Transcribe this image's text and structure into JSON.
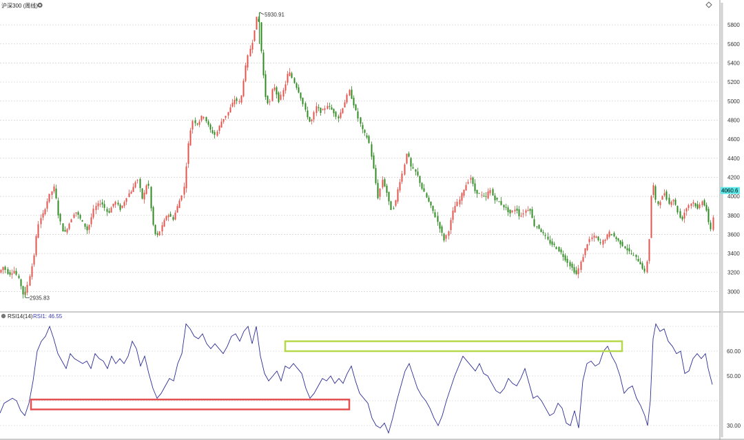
{
  "header": {
    "title": "沪深300 (周线)",
    "gear_icon": "gear-icon",
    "diamond_icon": "diamond-icon"
  },
  "indicator": {
    "label": "RSI14(14)",
    "value_label": "RSI1: 46.55"
  },
  "colors": {
    "up": "#e5534b",
    "down": "#2e8b22",
    "rsi_line": "#2b2b96",
    "grid": "#c8c8c8",
    "price_badge": "#5ce8e8",
    "rsi_highlight_high": "#b6d84a",
    "rsi_highlight_low": "#e55050"
  },
  "chart_data": [
    {
      "type": "candlestick",
      "title": "沪深300 (周线)",
      "yticks": [
        3000,
        3200,
        3400,
        3600,
        3800,
        4000,
        4200,
        4400,
        4600,
        4800,
        5000,
        5200,
        5400,
        5600,
        5800
      ],
      "ylim": [
        2880,
        5960
      ],
      "grid": true,
      "annotations": [
        {
          "text": "5930.91",
          "price": 5930.91,
          "kind": "high"
        },
        {
          "text": "2935.83",
          "price": 2935.83,
          "kind": "low"
        }
      ],
      "current_price": "4060.6",
      "path": [
        [
          0,
          3200
        ],
        [
          6,
          3260
        ],
        [
          14,
          3180
        ],
        [
          22,
          3220
        ],
        [
          30,
          3100
        ],
        [
          36,
          2936
        ],
        [
          42,
          3100
        ],
        [
          50,
          3350
        ],
        [
          56,
          3700
        ],
        [
          64,
          3820
        ],
        [
          72,
          4000
        ],
        [
          80,
          4100
        ],
        [
          86,
          3800
        ],
        [
          94,
          3600
        ],
        [
          102,
          3720
        ],
        [
          110,
          3850
        ],
        [
          118,
          3760
        ],
        [
          128,
          3640
        ],
        [
          138,
          3880
        ],
        [
          148,
          3940
        ],
        [
          158,
          3820
        ],
        [
          168,
          3950
        ],
        [
          176,
          3860
        ],
        [
          186,
          4010
        ],
        [
          194,
          4080
        ],
        [
          200,
          4200
        ],
        [
          208,
          3960
        ],
        [
          216,
          4180
        ],
        [
          222,
          3740
        ],
        [
          228,
          3560
        ],
        [
          236,
          3680
        ],
        [
          244,
          3820
        ],
        [
          252,
          3760
        ],
        [
          260,
          3920
        ],
        [
          268,
          4080
        ],
        [
          274,
          4520
        ],
        [
          280,
          4800
        ],
        [
          288,
          4760
        ],
        [
          296,
          4860
        ],
        [
          306,
          4700
        ],
        [
          314,
          4640
        ],
        [
          322,
          4780
        ],
        [
          332,
          4880
        ],
        [
          342,
          5020
        ],
        [
          350,
          4980
        ],
        [
          356,
          5300
        ],
        [
          362,
          5500
        ],
        [
          368,
          5640
        ],
        [
          372,
          5820
        ],
        [
          376,
          5931
        ],
        [
          380,
          5540
        ],
        [
          386,
          5060
        ],
        [
          392,
          4950
        ],
        [
          398,
          5180
        ],
        [
          406,
          5000
        ],
        [
          414,
          5140
        ],
        [
          420,
          5320
        ],
        [
          428,
          5200
        ],
        [
          436,
          5080
        ],
        [
          444,
          4900
        ],
        [
          452,
          4760
        ],
        [
          460,
          4940
        ],
        [
          468,
          4880
        ],
        [
          476,
          4960
        ],
        [
          484,
          4900
        ],
        [
          492,
          4820
        ],
        [
          500,
          4960
        ],
        [
          508,
          5110
        ],
        [
          514,
          4980
        ],
        [
          520,
          4840
        ],
        [
          528,
          4680
        ],
        [
          536,
          4600
        ],
        [
          544,
          4260
        ],
        [
          550,
          3980
        ],
        [
          556,
          4180
        ],
        [
          562,
          4060
        ],
        [
          568,
          3860
        ],
        [
          574,
          3900
        ],
        [
          580,
          4120
        ],
        [
          586,
          4260
        ],
        [
          592,
          4480
        ],
        [
          598,
          4300
        ],
        [
          606,
          4240
        ],
        [
          614,
          4080
        ],
        [
          622,
          3960
        ],
        [
          630,
          3840
        ],
        [
          638,
          3700
        ],
        [
          646,
          3540
        ],
        [
          652,
          3640
        ],
        [
          660,
          3880
        ],
        [
          668,
          3960
        ],
        [
          676,
          4100
        ],
        [
          684,
          4200
        ],
        [
          690,
          4060
        ],
        [
          698,
          4020
        ],
        [
          706,
          3980
        ],
        [
          712,
          4080
        ],
        [
          718,
          3980
        ],
        [
          726,
          3940
        ],
        [
          734,
          3880
        ],
        [
          742,
          3820
        ],
        [
          750,
          3880
        ],
        [
          756,
          3780
        ],
        [
          762,
          3840
        ],
        [
          770,
          3880
        ],
        [
          776,
          3700
        ],
        [
          782,
          3680
        ],
        [
          790,
          3600
        ],
        [
          798,
          3520
        ],
        [
          806,
          3480
        ],
        [
          814,
          3420
        ],
        [
          822,
          3340
        ],
        [
          830,
          3260
        ],
        [
          838,
          3180
        ],
        [
          846,
          3340
        ],
        [
          852,
          3480
        ],
        [
          858,
          3560
        ],
        [
          866,
          3580
        ],
        [
          872,
          3500
        ],
        [
          878,
          3540
        ],
        [
          886,
          3620
        ],
        [
          892,
          3580
        ],
        [
          900,
          3520
        ],
        [
          906,
          3480
        ],
        [
          914,
          3420
        ],
        [
          920,
          3380
        ],
        [
          926,
          3340
        ],
        [
          932,
          3280
        ],
        [
          938,
          3180
        ],
        [
          943,
          3500
        ],
        [
          948,
          4200
        ],
        [
          954,
          3900
        ],
        [
          960,
          3960
        ],
        [
          966,
          4040
        ],
        [
          972,
          3920
        ],
        [
          978,
          3980
        ],
        [
          984,
          3860
        ],
        [
          990,
          3740
        ],
        [
          996,
          3860
        ],
        [
          1002,
          3920
        ],
        [
          1008,
          3940
        ],
        [
          1014,
          3860
        ],
        [
          1020,
          3960
        ],
        [
          1026,
          3880
        ],
        [
          1032,
          3620
        ],
        [
          1036,
          3780
        ]
      ]
    },
    {
      "type": "line",
      "title": "RSI14(14)",
      "series": [
        {
          "name": "RSI1",
          "last": 46.55
        }
      ],
      "yticks": [
        30,
        50,
        60
      ],
      "ylim": [
        25,
        75
      ],
      "path": [
        [
          0,
          35
        ],
        [
          6,
          39
        ],
        [
          12,
          40
        ],
        [
          18,
          41
        ],
        [
          24,
          40
        ],
        [
          30,
          36
        ],
        [
          36,
          34
        ],
        [
          42,
          39
        ],
        [
          48,
          48
        ],
        [
          54,
          60
        ],
        [
          60,
          64
        ],
        [
          66,
          66
        ],
        [
          72,
          70
        ],
        [
          78,
          65
        ],
        [
          84,
          59
        ],
        [
          90,
          56
        ],
        [
          96,
          53
        ],
        [
          102,
          59
        ],
        [
          108,
          57
        ],
        [
          114,
          56
        ],
        [
          120,
          55
        ],
        [
          126,
          56
        ],
        [
          132,
          53
        ],
        [
          138,
          59
        ],
        [
          144,
          57
        ],
        [
          150,
          56
        ],
        [
          156,
          53
        ],
        [
          162,
          58
        ],
        [
          168,
          55
        ],
        [
          174,
          57
        ],
        [
          180,
          55
        ],
        [
          186,
          58
        ],
        [
          192,
          64
        ],
        [
          198,
          61
        ],
        [
          204,
          54
        ],
        [
          210,
          58
        ],
        [
          216,
          51
        ],
        [
          222,
          45
        ],
        [
          228,
          41
        ],
        [
          234,
          43
        ],
        [
          240,
          46
        ],
        [
          246,
          49
        ],
        [
          252,
          48
        ],
        [
          258,
          55
        ],
        [
          264,
          59
        ],
        [
          270,
          71
        ],
        [
          276,
          69
        ],
        [
          282,
          66
        ],
        [
          288,
          65
        ],
        [
          294,
          67
        ],
        [
          300,
          63
        ],
        [
          306,
          61
        ],
        [
          312,
          63
        ],
        [
          318,
          61
        ],
        [
          324,
          59
        ],
        [
          330,
          62
        ],
        [
          336,
          66
        ],
        [
          342,
          67
        ],
        [
          348,
          64
        ],
        [
          354,
          68
        ],
        [
          360,
          70
        ],
        [
          366,
          63
        ],
        [
          372,
          70
        ],
        [
          378,
          58
        ],
        [
          384,
          51
        ],
        [
          390,
          48
        ],
        [
          396,
          50
        ],
        [
          402,
          52
        ],
        [
          408,
          48
        ],
        [
          414,
          54
        ],
        [
          420,
          53
        ],
        [
          426,
          55
        ],
        [
          432,
          53
        ],
        [
          438,
          51
        ],
        [
          444,
          45
        ],
        [
          450,
          41
        ],
        [
          456,
          43
        ],
        [
          462,
          46
        ],
        [
          468,
          49
        ],
        [
          474,
          48
        ],
        [
          480,
          50
        ],
        [
          486,
          47
        ],
        [
          492,
          49
        ],
        [
          498,
          47
        ],
        [
          504,
          51
        ],
        [
          510,
          54
        ],
        [
          516,
          48
        ],
        [
          522,
          43
        ],
        [
          528,
          41
        ],
        [
          534,
          39
        ],
        [
          540,
          33
        ],
        [
          546,
          30
        ],
        [
          552,
          29
        ],
        [
          558,
          31
        ],
        [
          564,
          27
        ],
        [
          570,
          33
        ],
        [
          576,
          40
        ],
        [
          582,
          46
        ],
        [
          588,
          52
        ],
        [
          594,
          55
        ],
        [
          600,
          50
        ],
        [
          606,
          45
        ],
        [
          612,
          42
        ],
        [
          618,
          40
        ],
        [
          624,
          37
        ],
        [
          630,
          33
        ],
        [
          636,
          30
        ],
        [
          642,
          34
        ],
        [
          648,
          40
        ],
        [
          654,
          45
        ],
        [
          660,
          50
        ],
        [
          666,
          54
        ],
        [
          672,
          58
        ],
        [
          678,
          56
        ],
        [
          684,
          54
        ],
        [
          690,
          52
        ],
        [
          696,
          55
        ],
        [
          702,
          51
        ],
        [
          708,
          50
        ],
        [
          714,
          47
        ],
        [
          720,
          44
        ],
        [
          726,
          43
        ],
        [
          732,
          45
        ],
        [
          738,
          49
        ],
        [
          744,
          47
        ],
        [
          750,
          46
        ],
        [
          756,
          49
        ],
        [
          762,
          53
        ],
        [
          768,
          47
        ],
        [
          774,
          41
        ],
        [
          780,
          42
        ],
        [
          786,
          40
        ],
        [
          792,
          37
        ],
        [
          798,
          34
        ],
        [
          804,
          35
        ],
        [
          810,
          39
        ],
        [
          816,
          37
        ],
        [
          822,
          31
        ],
        [
          828,
          30
        ],
        [
          834,
          36
        ],
        [
          840,
          29
        ],
        [
          846,
          48
        ],
        [
          852,
          55
        ],
        [
          858,
          56
        ],
        [
          864,
          54
        ],
        [
          870,
          55
        ],
        [
          876,
          60
        ],
        [
          882,
          62
        ],
        [
          888,
          58
        ],
        [
          894,
          55
        ],
        [
          900,
          50
        ],
        [
          906,
          43
        ],
        [
          912,
          45
        ],
        [
          918,
          46
        ],
        [
          924,
          41
        ],
        [
          930,
          38
        ],
        [
          936,
          34
        ],
        [
          940,
          30
        ],
        [
          944,
          40
        ],
        [
          948,
          65
        ],
        [
          952,
          71
        ],
        [
          958,
          68
        ],
        [
          964,
          69
        ],
        [
          970,
          64
        ],
        [
          976,
          62
        ],
        [
          982,
          59
        ],
        [
          988,
          60
        ],
        [
          994,
          51
        ],
        [
          1000,
          52
        ],
        [
          1006,
          57
        ],
        [
          1012,
          59
        ],
        [
          1018,
          57
        ],
        [
          1024,
          59
        ],
        [
          1028,
          53
        ],
        [
          1034,
          46.55
        ]
      ],
      "highlights": [
        {
          "kind": "high",
          "x0": 414,
          "x1": 903,
          "v_top": 64,
          "v_bottom": 60
        },
        {
          "kind": "low",
          "x0": 45,
          "x1": 507,
          "v_top": 40.5,
          "v_bottom": 36.5
        }
      ]
    }
  ]
}
